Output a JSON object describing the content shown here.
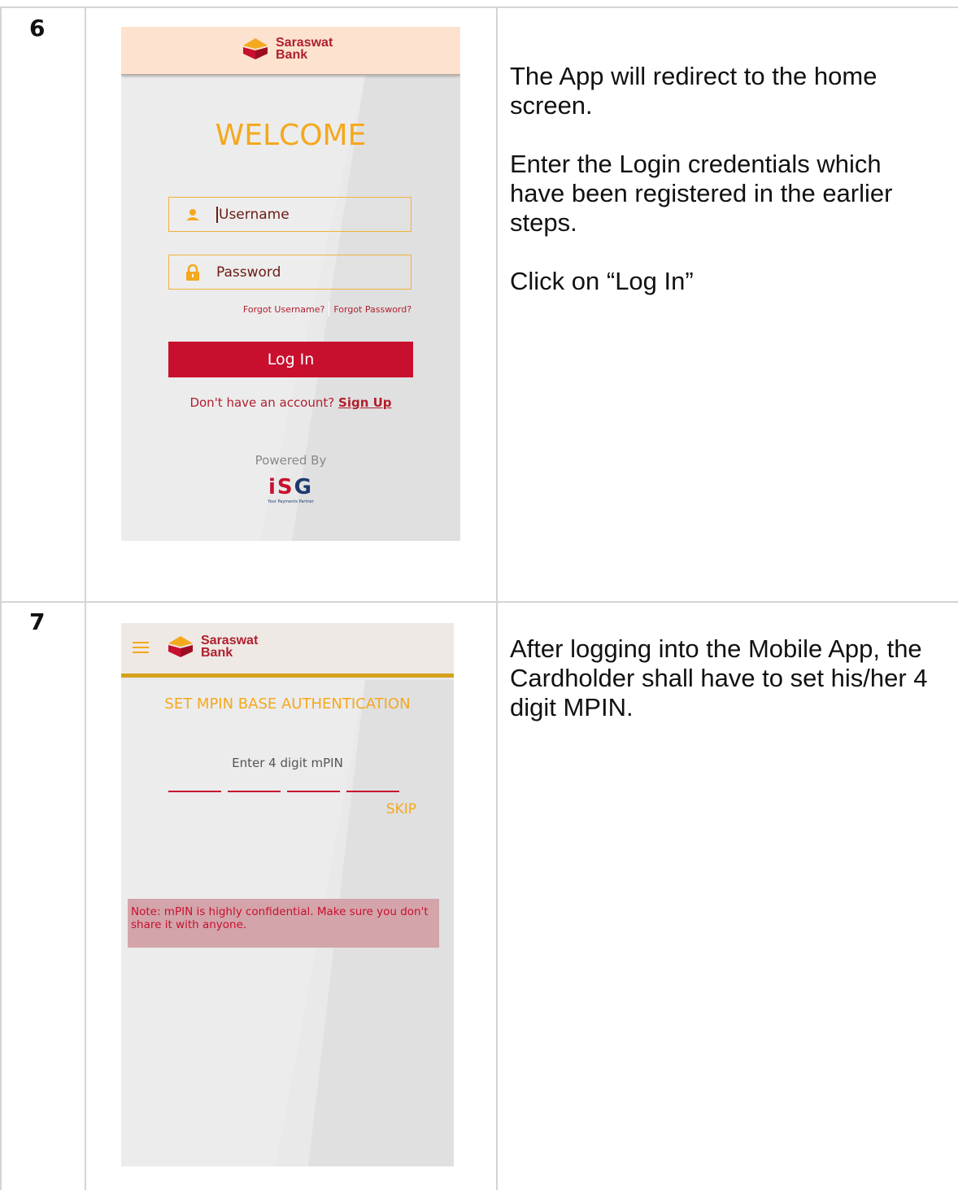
{
  "steps": [
    {
      "number": "6",
      "screen": {
        "bank_name_line1": "Saraswat",
        "bank_name_line2": "Bank",
        "welcome": "WELCOME",
        "username_placeholder": "Username",
        "password_placeholder": "Password",
        "forgot_username": "Forgot Username?",
        "forgot_password": "Forgot Password?",
        "login_button": "Log In",
        "no_account_text": "Don't have an account?",
        "sign_up": "Sign Up",
        "powered_by": "Powered By",
        "isg_logo": "iSG",
        "isg_tagline": "Your Payments Partner"
      },
      "description": [
        "The App will redirect to the home screen.",
        "Enter the Login credentials which have been registered in the earlier steps.",
        "Click on “Log In”"
      ]
    },
    {
      "number": "7",
      "screen": {
        "bank_name_line1": "Saraswat",
        "bank_name_line2": "Bank",
        "title": "SET MPIN BASE AUTHENTICATION",
        "mpin_label": "Enter 4 digit mPIN",
        "pin_digits": 4,
        "skip": "SKIP",
        "note": "Note: mPIN is highly confidential. Make sure you don't share it with anyone."
      },
      "description": [
        "After logging into the Mobile App, the Cardholder shall have to set his/her 4 digit MPIN."
      ]
    }
  ],
  "colors": {
    "brand_red": "#c8102e",
    "accent_orange": "#f4a81d",
    "header_peach": "#fde3cf"
  },
  "icons": [
    "saraswat-logo",
    "user-icon",
    "lock-icon",
    "menu-icon",
    "isg-logo"
  ]
}
